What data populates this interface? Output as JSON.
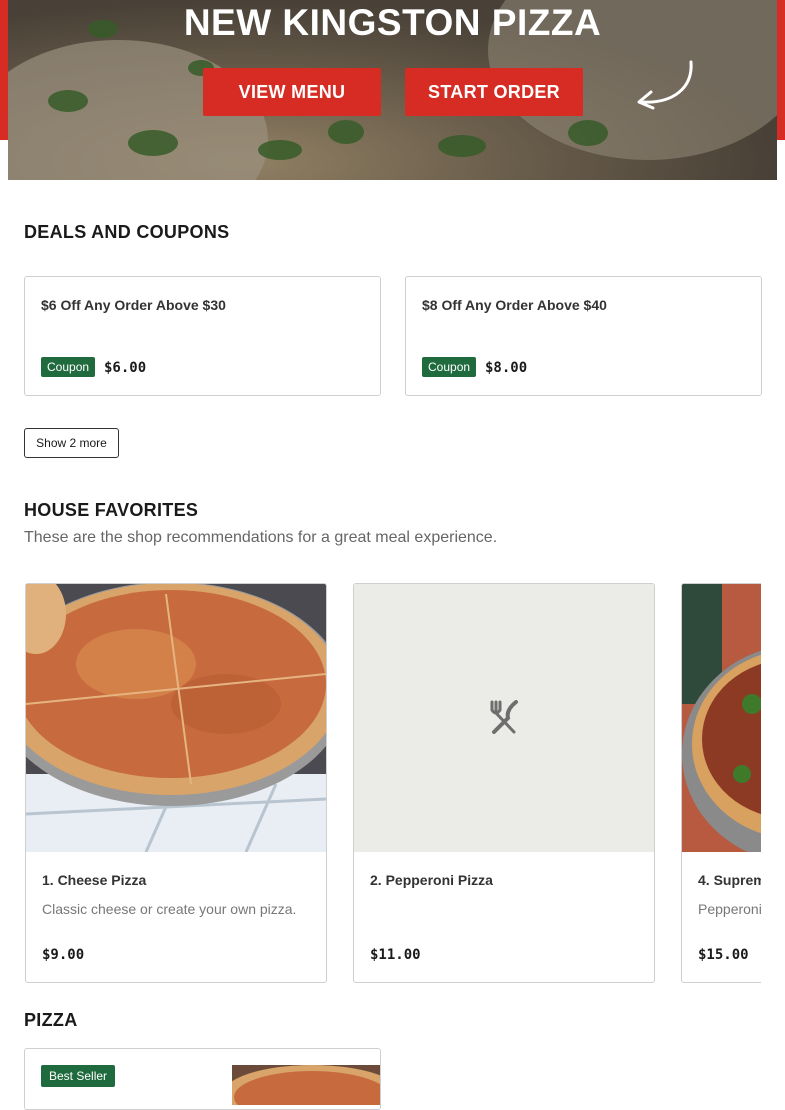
{
  "hero": {
    "title": "NEW KINGSTON PIZZA",
    "view_menu_label": "VIEW MENU",
    "start_order_label": "START ORDER"
  },
  "deals": {
    "title": "DEALS AND COUPONS",
    "coupons": [
      {
        "title": "$6 Off Any Order Above $30",
        "badge": "Coupon",
        "amount": "$6.00"
      },
      {
        "title": "$8 Off Any Order Above $40",
        "badge": "Coupon",
        "amount": "$8.00"
      }
    ],
    "show_more_label": "Show 2 more"
  },
  "favorites": {
    "title": "HOUSE FAVORITES",
    "subtitle": "These are the shop recommendations for a great meal experience.",
    "items": [
      {
        "name": "1. Cheese Pizza",
        "description": "Classic cheese or create your own pizza.",
        "price": "$9.00"
      },
      {
        "name": "2. Pepperoni Pizza",
        "description": "",
        "price": "$11.00"
      },
      {
        "name": "4. Suprem",
        "description": "Pepperoni peppers, s",
        "price": "$15.00"
      }
    ]
  },
  "pizza": {
    "title": "PIZZA",
    "first_badge": "Best Seller"
  },
  "colors": {
    "brand_red": "#d62c23",
    "coupon_green": "#1f6b3d"
  },
  "icons": {
    "hero_arrow": "curved-arrow-icon",
    "placeholder": "fork-knife-icon"
  }
}
